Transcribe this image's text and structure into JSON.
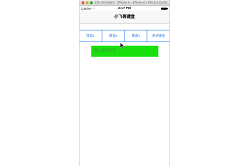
{
  "window": {
    "title": "iOS Simulator - iPhone 6 - iPhone 6 / iOS 8.4 (12H141)"
  },
  "statusbar": {
    "carrier": "Carrier",
    "wifi_icon": "wifi-icon",
    "time": "2:17 PM",
    "battery_level": 1.0
  },
  "navbar": {
    "title": "小飞哥键盘"
  },
  "button_bar": {
    "buttons": [
      "键盘1",
      "键盘2",
      "键盘3",
      "系统键盘"
    ]
  },
  "text_field": {
    "placeholder": "输入你的昵称",
    "background": "#17e00d"
  }
}
